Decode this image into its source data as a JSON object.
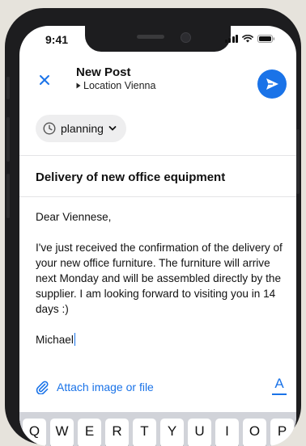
{
  "status_bar": {
    "time": "9:41"
  },
  "header": {
    "title": "New Post",
    "location": "Location Vienna",
    "close_icon": "close-icon",
    "send_icon": "send-icon"
  },
  "status_chip": {
    "label": "planning",
    "icon": "clock-icon"
  },
  "post": {
    "subject": "Delivery of new office equipment",
    "greeting": "Dear Viennese,",
    "body": "I've just received the confirmation of the delivery of your new office furniture. The furniture will arrive next Monday and will be assembled directly by the supplier. I am looking forward to visiting you in 14 days :)",
    "signature": "Michael"
  },
  "toolbar": {
    "attach_label": "Attach image or file",
    "format_label": "A"
  },
  "keyboard": {
    "row1": [
      "Q",
      "W",
      "E",
      "R",
      "T",
      "Y",
      "U",
      "I",
      "O",
      "P"
    ]
  },
  "colors": {
    "accent": "#1a73e8",
    "background": "#e6e3dc",
    "chip": "#eeeeef"
  }
}
